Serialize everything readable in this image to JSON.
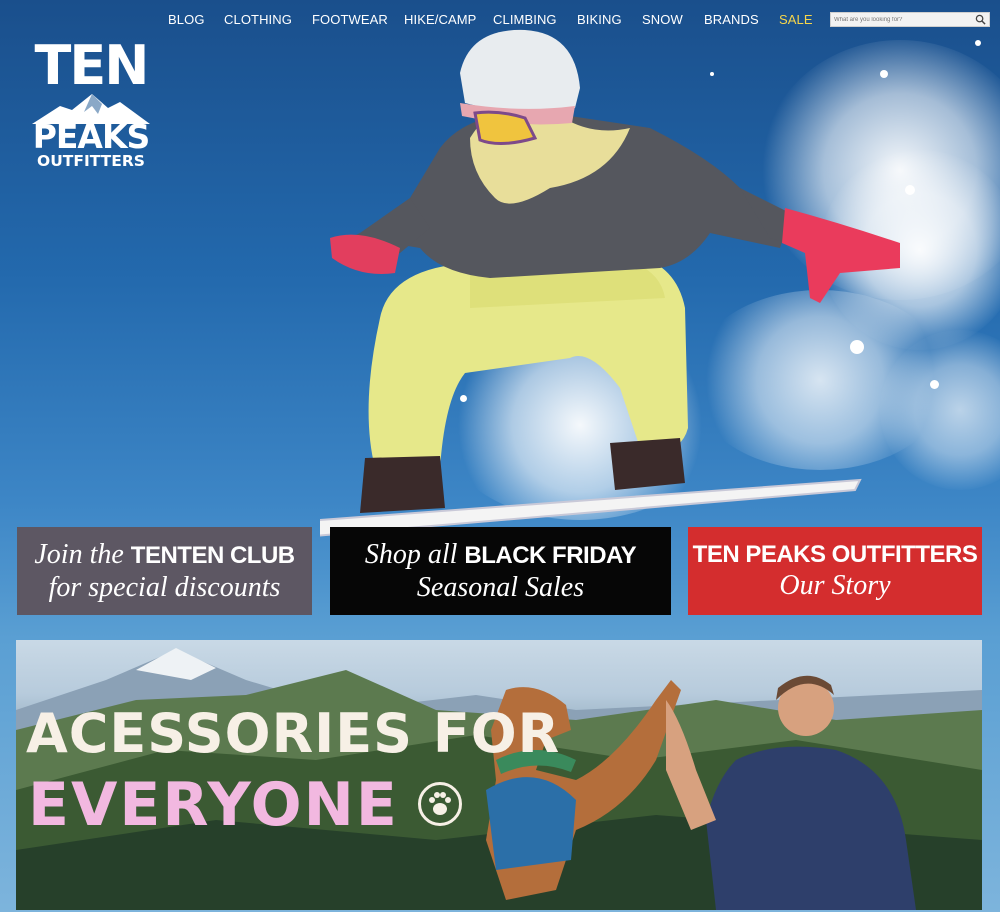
{
  "nav": {
    "items": [
      "BLOG",
      "CLOTHING",
      "FOOTWEAR",
      "HIKE/CAMP",
      "CLIMBING",
      "BIKING",
      "SNOW",
      "BRANDS",
      "SALE"
    ],
    "sale_color": "#f6d54a"
  },
  "search": {
    "placeholder": "What are you looking for?",
    "icon": "search-icon"
  },
  "logo": {
    "line1": "TEN",
    "line2": "PEAKS",
    "line3": "OUTFITTERS"
  },
  "promos": {
    "club": {
      "line1_italic": "Join the ",
      "line1_bold": "TENTEN CLUB",
      "line2": "for special discounts",
      "bg": "#5d5763"
    },
    "black_friday": {
      "line1_italic": "Shop all ",
      "line1_bold": "BLACK FRIDAY",
      "line2": "Seasonal Sales",
      "bg": "#060606"
    },
    "story": {
      "line1_bold": "TEN PEAKS OUTFITTERS",
      "line2": "Our Story",
      "bg": "#d42d2e"
    }
  },
  "banner": {
    "title_line1": "ACESSORIES FOR",
    "title_line2": "EVERYONE",
    "title2_color": "#f2b8e0",
    "icon": "paw-icon"
  }
}
